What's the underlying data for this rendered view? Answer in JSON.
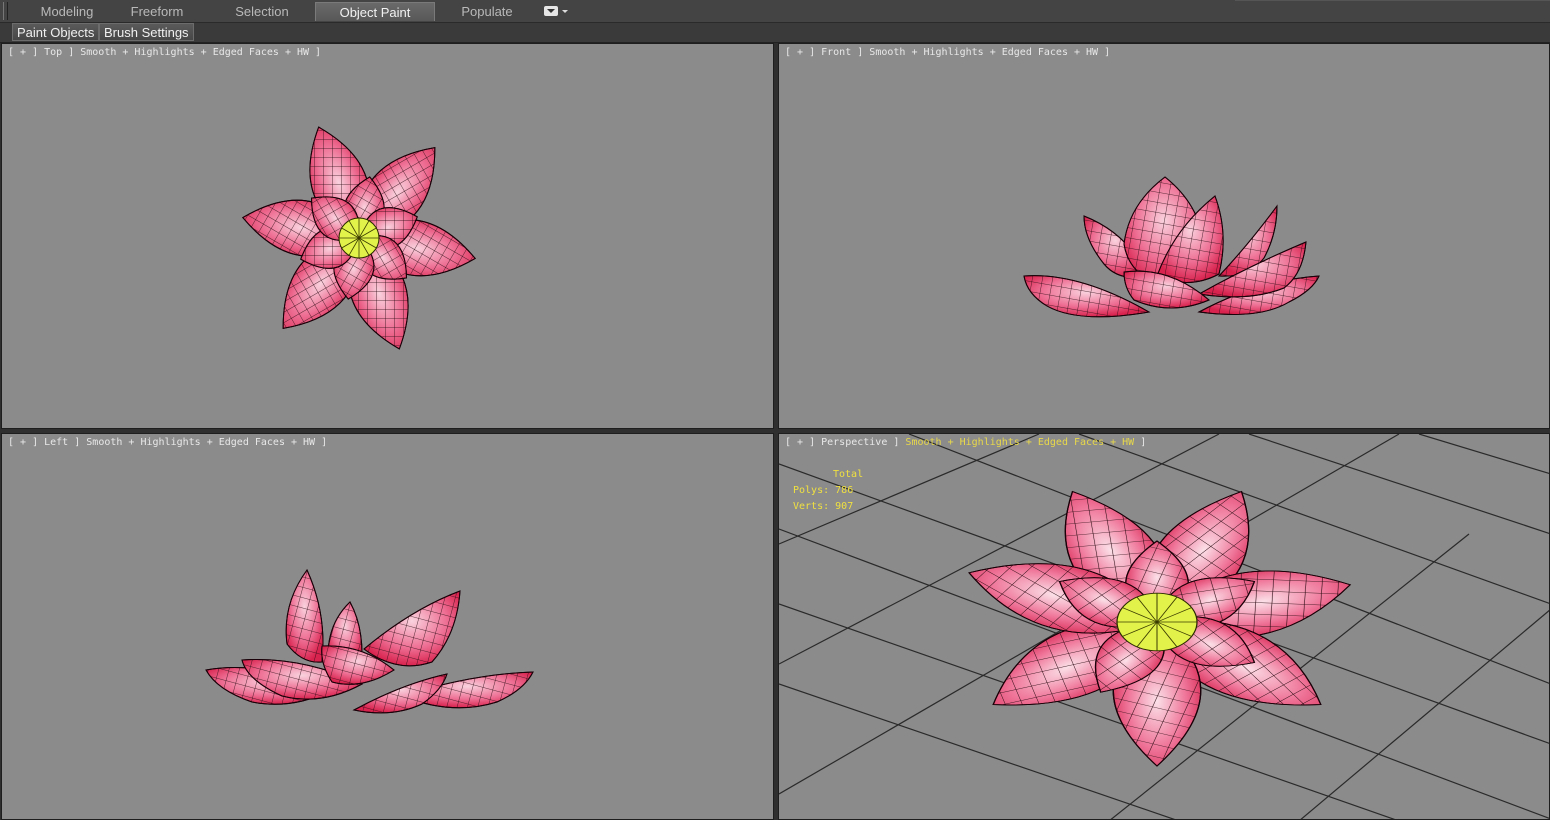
{
  "ribbon": {
    "tabs": [
      {
        "label": "Modeling",
        "active": false
      },
      {
        "label": "Freeform",
        "active": false
      },
      {
        "label": "Selection",
        "active": false
      },
      {
        "label": "Object Paint",
        "active": true
      },
      {
        "label": "Populate",
        "active": false
      }
    ]
  },
  "panel": {
    "buttons": [
      "Paint Objects",
      "Brush Settings"
    ]
  },
  "viewports": {
    "top": {
      "open": "[ + ] ",
      "view": "Top",
      "sep": " ] ",
      "mode": "Smooth + Highlights + Edged Faces + HW",
      "close": " ]"
    },
    "front": {
      "open": "[ + ] ",
      "view": "Front",
      "sep": " ] ",
      "mode": "Smooth + Highlights + Edged Faces + HW",
      "close": " ]"
    },
    "left": {
      "open": "[ + ] ",
      "view": "Left",
      "sep": " ] ",
      "mode": "Smooth + Highlights + Edged Faces + HW",
      "close": " ]"
    },
    "perspective": {
      "open": "[ + ] ",
      "view": "Perspective",
      "sep": " ] ",
      "mode": "Smooth + Highlights + Edged Faces + HW",
      "close": " ]"
    }
  },
  "stats": {
    "header": "Total",
    "polys_label": "Polys:",
    "polys": "786",
    "verts_label": "Verts:",
    "verts": "907"
  },
  "colors": {
    "viewport_bg": "#8b8b8b",
    "petal_dark": "#d8234e",
    "petal_light": "#f7c4d3",
    "center": "#e2f24a",
    "active_label": "#e8d84a"
  }
}
